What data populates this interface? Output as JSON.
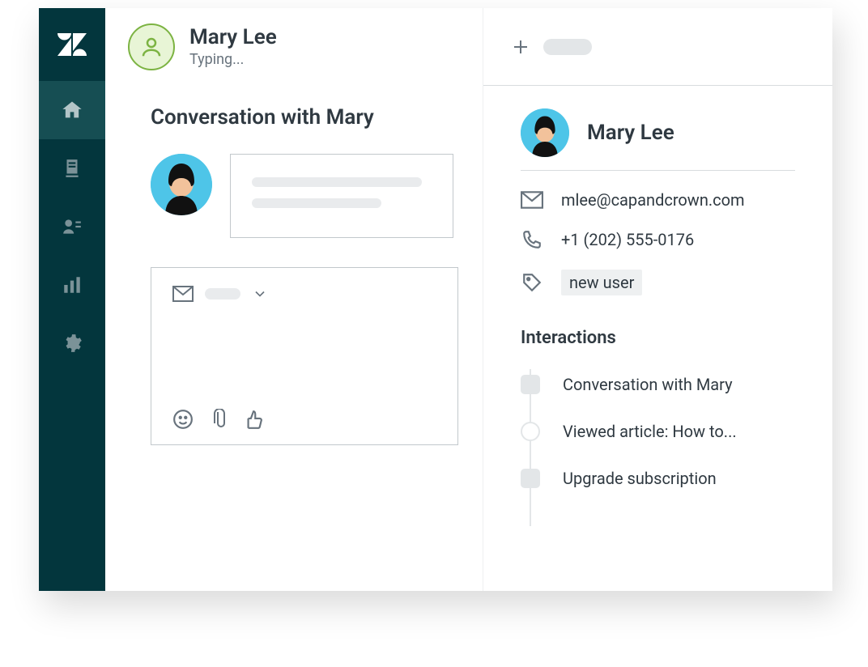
{
  "header": {
    "user_name": "Mary Lee",
    "status": "Typing..."
  },
  "conversation": {
    "title": "Conversation with Mary"
  },
  "profile": {
    "name": "Mary Lee",
    "email": "mlee@capandcrown.com",
    "phone": "+1 (202) 555-0176",
    "tag": "new user",
    "avatar_name": "mary-lee-avatar"
  },
  "interactions": {
    "title": "Interactions",
    "items": [
      {
        "label": "Conversation with Mary",
        "shape": "square"
      },
      {
        "label": "Viewed article: How to...",
        "shape": "circle"
      },
      {
        "label": "Upgrade subscription",
        "shape": "square"
      }
    ]
  },
  "icons": {
    "logo": "zendesk-logo",
    "home": "home-icon",
    "views": "document-icon",
    "customers": "user-list-icon",
    "reports": "bar-chart-icon",
    "admin": "gear-icon",
    "person": "person-outline-icon",
    "plus": "plus-icon",
    "mail": "mail-icon",
    "chevron": "chevron-down-icon",
    "emoji": "emoji-icon",
    "attach": "paperclip-icon",
    "thumbs": "thumbs-up-icon",
    "phone": "phone-icon",
    "tag": "tag-icon"
  }
}
